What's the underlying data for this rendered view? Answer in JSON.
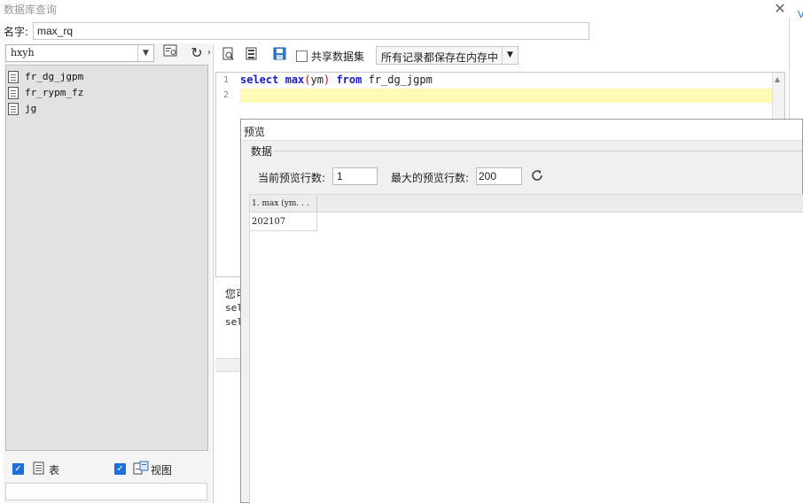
{
  "dialog": {
    "title": "数据库查询",
    "name_label": "名字:",
    "name_value": "max_rq"
  },
  "left": {
    "db_selected": "hxyh",
    "tables": [
      "fr_dg_jgpm",
      "fr_rypm_fz",
      "jg"
    ],
    "show_table_label": "表",
    "show_view_label": "视图"
  },
  "toolbar": {
    "share_label": "共享数据集",
    "mode_value": "所有记录都保存在内存中"
  },
  "editor": {
    "line_numbers": [
      "1",
      "2"
    ],
    "kw_select": "select",
    "kw_fn": "max",
    "open_paren": "(",
    "arg": "ym",
    "close_paren": ")",
    "kw_from": "from",
    "table": "fr_dg_jgpm"
  },
  "messages": {
    "line1": "您可",
    "line2": "sel",
    "line3": "sel"
  },
  "preview": {
    "title": "预览",
    "group_label": "数据",
    "current_rows_label": "当前预览行数:",
    "current_rows_value": "1",
    "max_rows_label": "最大的预览行数:",
    "max_rows_value": "200",
    "column_header": "1.  max (ym. . .",
    "cell_value": "202107"
  },
  "colors": {
    "keyword": "#1a1acc",
    "line_highlight": "#fffbb6",
    "checkbox": "#1e6fd9"
  }
}
